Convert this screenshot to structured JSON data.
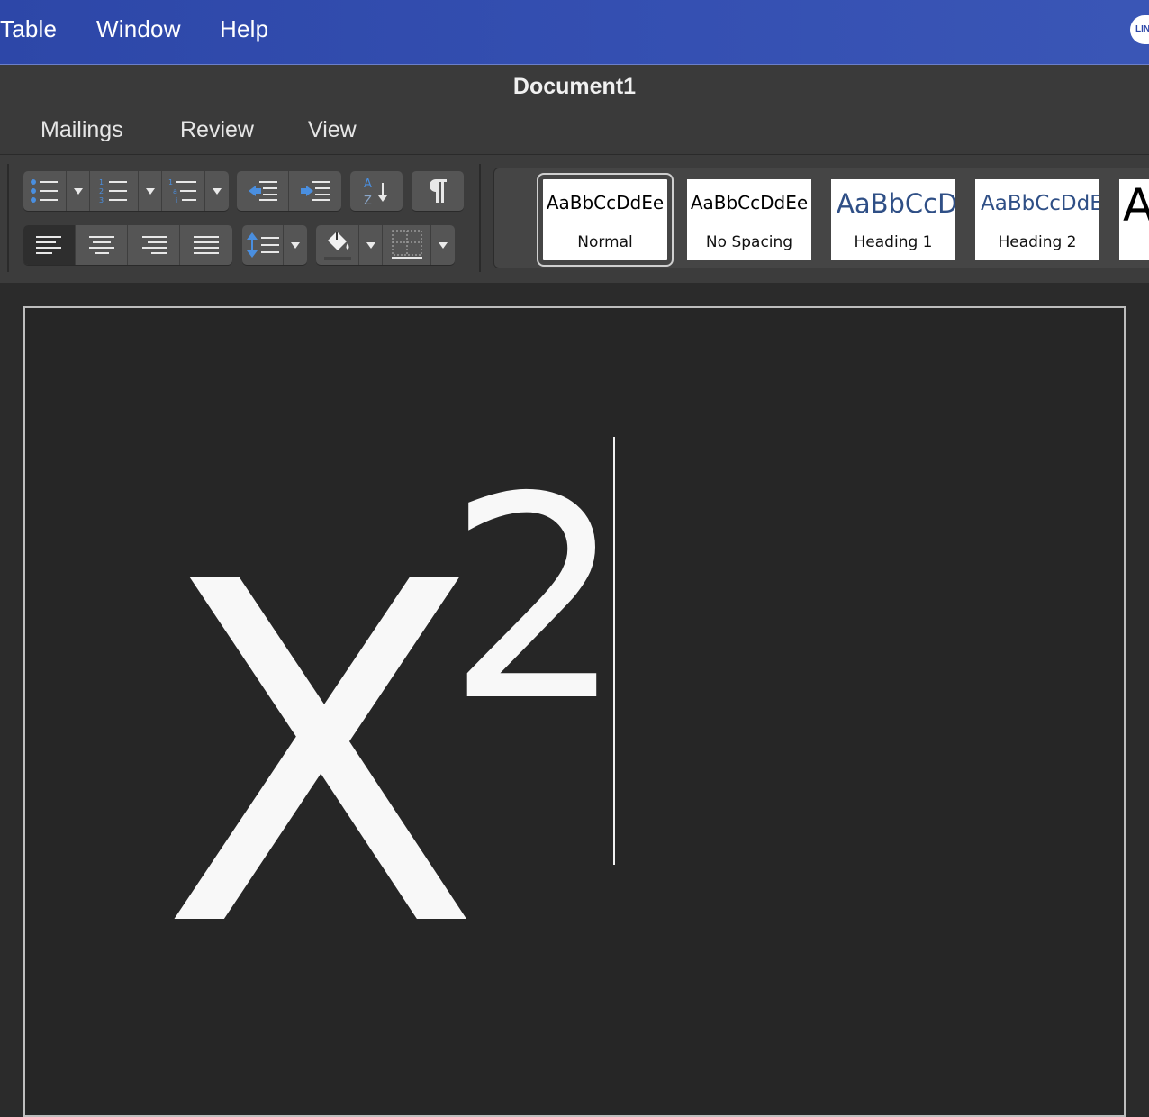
{
  "menubar": {
    "items": [
      "Table",
      "Window",
      "Help"
    ],
    "status_icon_label": "LIN"
  },
  "window": {
    "title": "Document1"
  },
  "ribbon": {
    "tabs": [
      "Mailings",
      "Review",
      "View"
    ],
    "icons": {
      "bullets": "bulleted-list-icon",
      "numbering": "numbered-list-icon",
      "multilevel": "multilevel-list-icon",
      "decrease_indent": "decrease-indent-icon",
      "increase_indent": "increase-indent-icon",
      "sort": "sort-az-icon",
      "show_marks": "pilcrow-icon",
      "align_left": "align-left-icon",
      "align_center": "align-center-icon",
      "align_right": "align-right-icon",
      "justify": "justify-icon",
      "line_spacing": "line-spacing-icon",
      "shading": "paint-bucket-icon",
      "borders": "borders-icon"
    },
    "styles": [
      {
        "sample": "AaBbCcDdEe",
        "name": "Normal",
        "selected": true
      },
      {
        "sample": "AaBbCcDdEe",
        "name": "No Spacing"
      },
      {
        "sample": "AaBbCcDc",
        "name": "Heading 1"
      },
      {
        "sample": "AaBbCcDdEe",
        "name": "Heading 2"
      },
      {
        "sample": "A",
        "name": ""
      }
    ]
  },
  "document": {
    "base": "X",
    "superscript": "2"
  },
  "colors": {
    "menubar": "#3550b2",
    "accent_icon": "#4a8fe0",
    "heading_style": "#2f4f86",
    "page_bg": "#262626",
    "text": "#f8f8f8"
  }
}
